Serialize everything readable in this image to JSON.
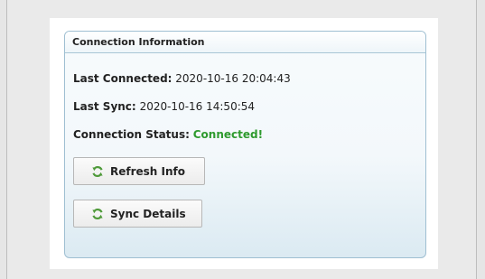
{
  "panel": {
    "title": "Connection Information",
    "last_connected": {
      "label": "Last Connected:",
      "value": "2020-10-16 20:04:43"
    },
    "last_sync": {
      "label": "Last Sync:",
      "value": "2020-10-16 14:50:54"
    },
    "connection_status": {
      "label": "Connection Status:",
      "value": "Connected!",
      "value_color": "#2e9a2e"
    }
  },
  "buttons": {
    "refresh_label": "Refresh Info",
    "sync_label": "Sync Details",
    "icon": "refresh-icon",
    "icon_color": "#4f9a3a"
  }
}
